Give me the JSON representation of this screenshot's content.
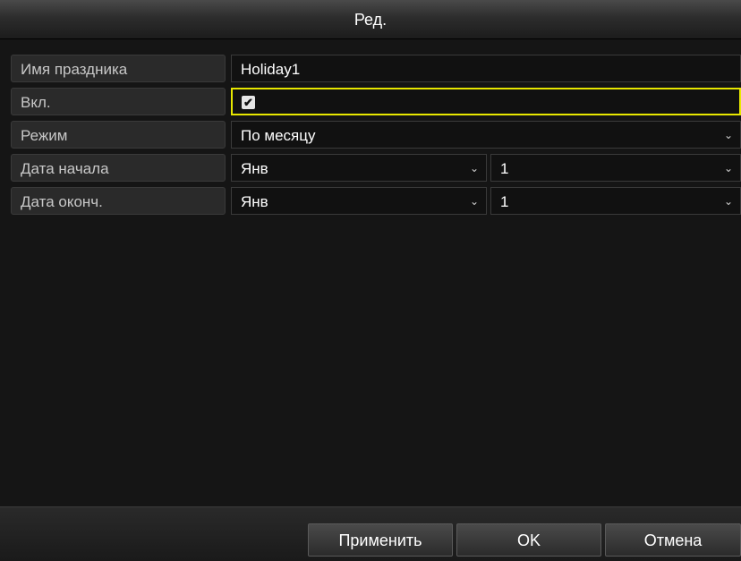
{
  "dialog": {
    "title": "Ред."
  },
  "fields": {
    "name": {
      "label": "Имя праздника",
      "value": "Holiday1"
    },
    "enabled": {
      "label": "Вкл.",
      "checked": true,
      "check_glyph": "✔"
    },
    "mode": {
      "label": "Режим",
      "value": "По месяцу"
    },
    "start": {
      "label": "Дата начала",
      "month": "Янв",
      "day": "1"
    },
    "end": {
      "label": "Дата оконч.",
      "month": "Янв",
      "day": "1"
    }
  },
  "icons": {
    "dropdown": "chevron-down-icon",
    "dropdown_glyph": "⌄"
  },
  "buttons": {
    "apply": "Применить",
    "ok": "OK",
    "cancel": "Отмена"
  },
  "colors": {
    "focus": "#e8e800"
  }
}
